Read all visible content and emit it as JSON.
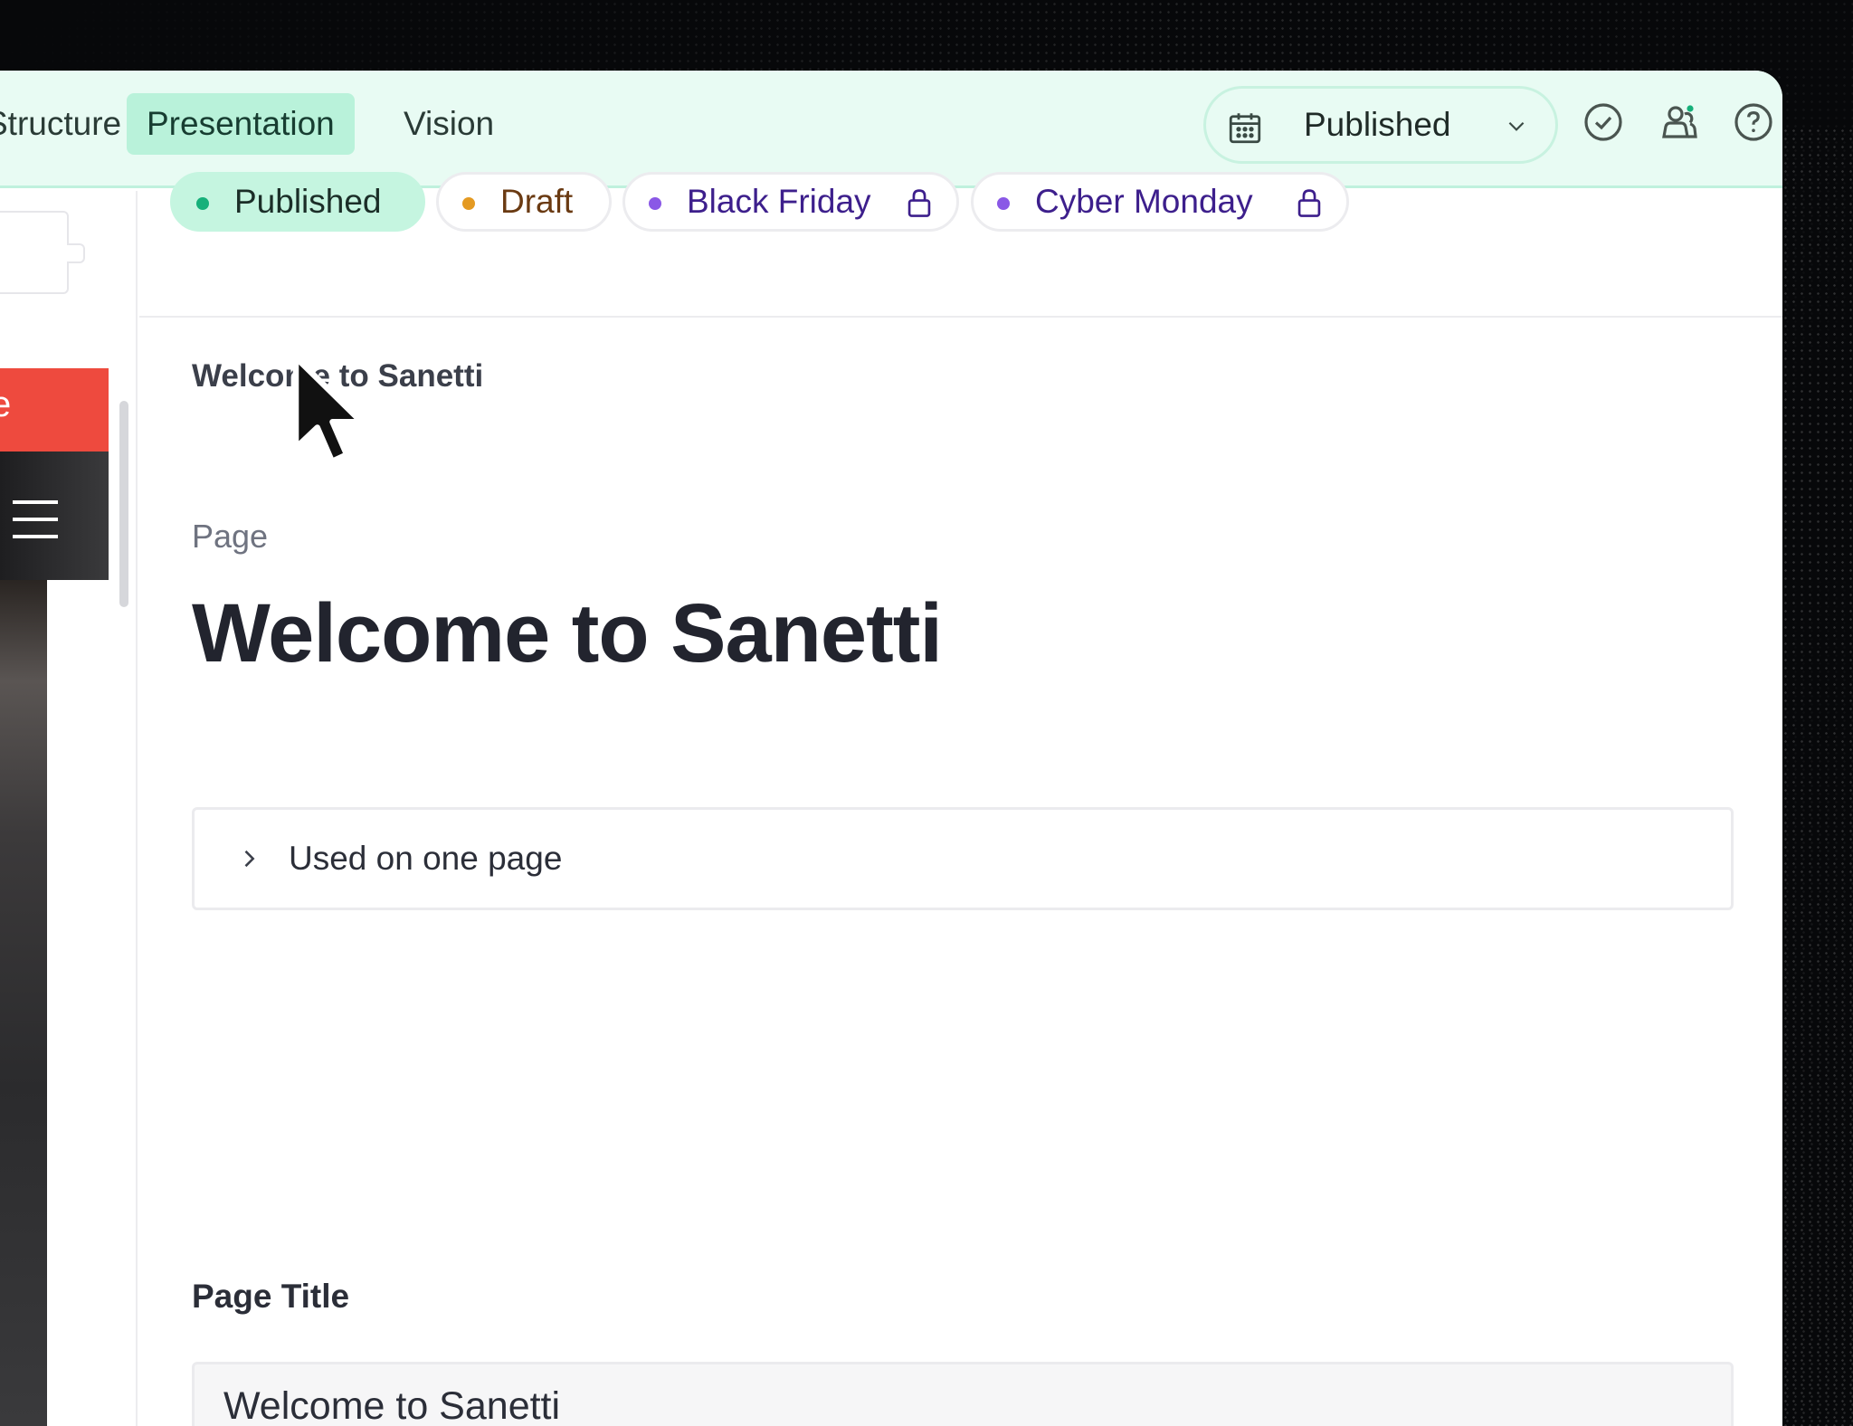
{
  "app": {
    "tabs": [
      {
        "label": "Structure",
        "active": false
      },
      {
        "label": "Presentation",
        "active": true
      },
      {
        "label": "Vision",
        "active": false
      }
    ],
    "status_select": {
      "label": "Published",
      "icon": "calendar-icon"
    },
    "toolbar_icons": [
      "check-circle-icon",
      "users-icon",
      "help-icon"
    ],
    "accent_color": "#b9f2da"
  },
  "variants": [
    {
      "label": "Published",
      "color": "#16b07a",
      "locked": false,
      "selected": true
    },
    {
      "label": "Draft",
      "color": "#e49a22",
      "locked": false,
      "selected": false
    },
    {
      "label": "Black Friday",
      "color": "#8a58e6",
      "locked": true,
      "selected": false
    },
    {
      "label": "Cyber Monday",
      "color": "#8a58e6",
      "locked": true,
      "selected": false
    }
  ],
  "document": {
    "breadcrumb": "Welcome to Sanetti",
    "type": "Page",
    "title": "Welcome to Sanetti",
    "usage": "Used on one page",
    "fields": {
      "page_title": {
        "label": "Page Title",
        "value": "Welcome to Sanetti"
      }
    }
  },
  "preview": {
    "label_fragment": "e"
  }
}
